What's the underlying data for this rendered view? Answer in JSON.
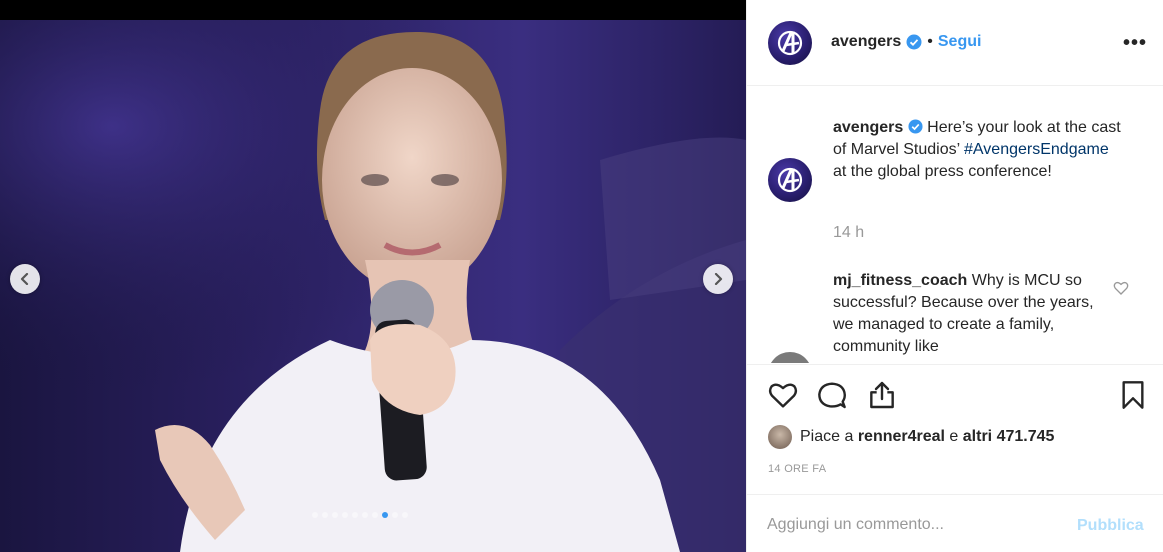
{
  "post": {
    "carousel": {
      "slide_count": 10,
      "active_index": 7,
      "prev_icon": "chevron-left-icon",
      "next_icon": "chevron-right-icon"
    },
    "header": {
      "username": "avengers",
      "separator": "•",
      "follow_label": "Segui",
      "more_label": "•••"
    },
    "caption": {
      "username": "avengers",
      "text_before": " Here’s your look at the cast of Marvel Studios’ ",
      "hashtag": "#AvengersEndgame",
      "text_after": " at the global press conference!",
      "time": "14 h"
    },
    "comment": {
      "username": "mj_fitness_coach",
      "text": " Why is MCU so successful? Because over the years, we managed to create a family, community like"
    },
    "likes": {
      "prefix": "Piace a ",
      "user": "renner4real",
      "middle": " e ",
      "others": "altri 471.745"
    },
    "timestamp": "14 ORE FA",
    "composer": {
      "placeholder": "Aggiungi un commento...",
      "publish_label": "Pubblica"
    },
    "colors": {
      "accent": "#3897f0",
      "hashtag": "#003569",
      "muted": "#999999",
      "publish_disabled": "#b2dffc"
    }
  }
}
